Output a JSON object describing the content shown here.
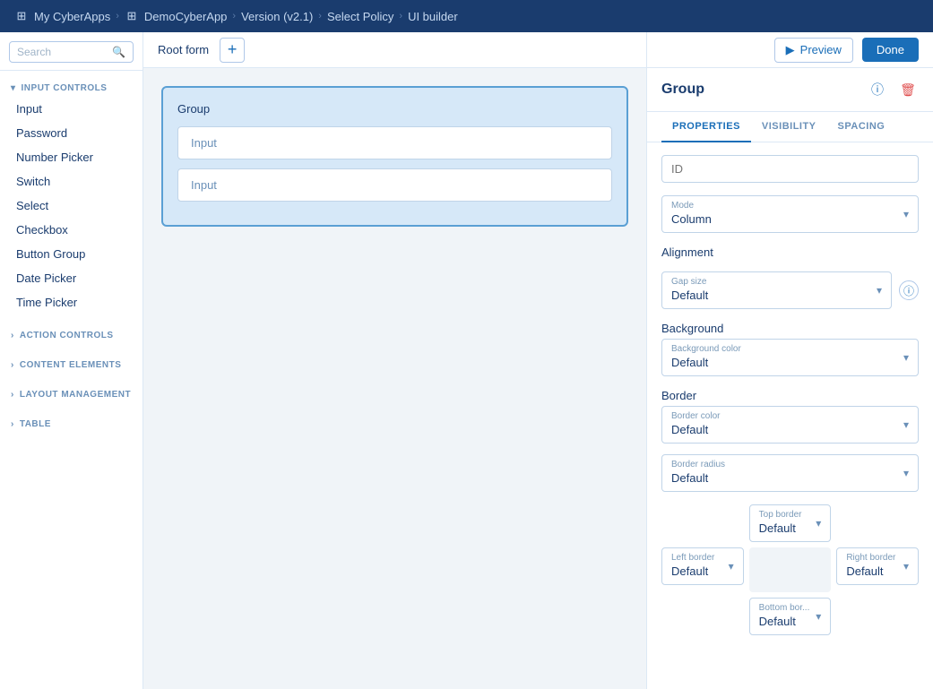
{
  "breadcrumb": {
    "items": [
      {
        "label": "My CyberApps",
        "icon": "apps-icon"
      },
      {
        "label": "DemoCyberApp",
        "icon": "grid-icon"
      },
      {
        "label": "Version (v2.1)"
      },
      {
        "label": "Select Policy"
      },
      {
        "label": "UI builder"
      }
    ]
  },
  "sidebar": {
    "search_placeholder": "Search",
    "sections": [
      {
        "id": "input-controls",
        "label": "INPUT CONTROLS",
        "expanded": true,
        "items": [
          "Input",
          "Password",
          "Number Picker",
          "Switch",
          "Select",
          "Checkbox",
          "Button Group",
          "Date Picker",
          "Time Picker"
        ]
      },
      {
        "id": "action-controls",
        "label": "ACTION CONTROLS",
        "expanded": false,
        "items": []
      },
      {
        "id": "content-elements",
        "label": "CONTENT ELEMENTS",
        "expanded": false,
        "items": []
      },
      {
        "id": "layout-management",
        "label": "LAYOUT MANAGEMENT",
        "expanded": false,
        "items": []
      },
      {
        "id": "table",
        "label": "TABLE",
        "expanded": false,
        "items": []
      }
    ]
  },
  "canvas": {
    "root_form_label": "Root form",
    "add_button_label": "+",
    "group": {
      "label": "Group",
      "inputs": [
        "Input",
        "Input"
      ]
    }
  },
  "toolbar": {
    "preview_label": "Preview",
    "done_label": "Done"
  },
  "properties_panel": {
    "title": "Group",
    "tabs": [
      "PROPERTIES",
      "VISIBILITY",
      "SPACING"
    ],
    "active_tab": "PROPERTIES",
    "fields": {
      "id_placeholder": "ID",
      "mode_label": "Mode",
      "mode_value": "Column",
      "alignment_label": "Alignment",
      "gap_size_label": "Gap size",
      "gap_size_value": "Default",
      "background_label": "Background",
      "background_color_label": "Background color",
      "background_color_value": "Default",
      "border_label": "Border",
      "border_color_label": "Border color",
      "border_color_value": "Default",
      "border_radius_label": "Border radius",
      "border_radius_value": "Default",
      "top_border_label": "Top border",
      "top_border_value": "Default",
      "left_border_label": "Left border",
      "left_border_value": "Default",
      "right_border_label": "Right border",
      "right_border_value": "Default",
      "bottom_border_label": "Bottom bor...",
      "bottom_border_value": "Default"
    }
  }
}
